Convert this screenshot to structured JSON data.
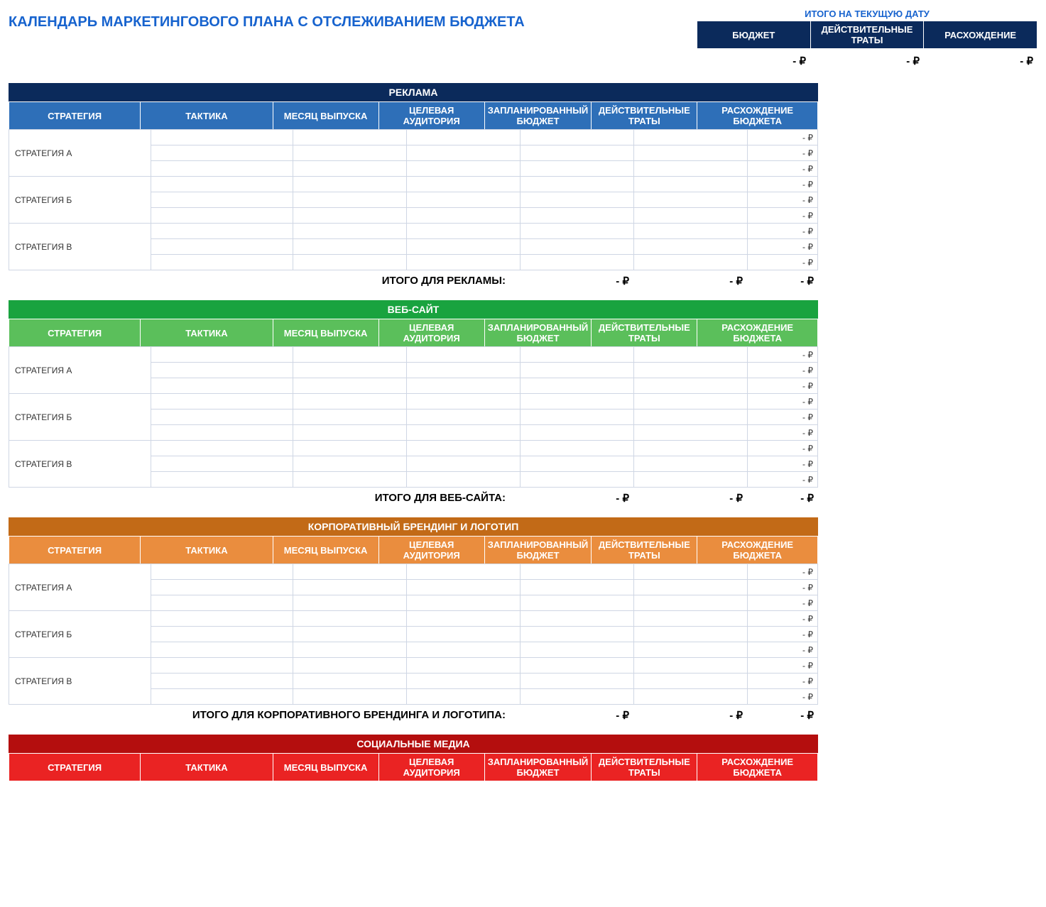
{
  "page_title": "КАЛЕНДАРЬ МАРКЕТИНГОВОГО ПЛАНА С ОТСЛЕЖИВАНИЕМ БЮДЖЕТА",
  "summary": {
    "top_label": "ИТОГО НА ТЕКУЩУЮ ДАТУ",
    "headers": [
      "БЮДЖЕТ",
      "ДЕЙСТВИТЕЛЬНЫЕ ТРАТЫ",
      "РАСХОЖДЕНИЕ"
    ],
    "values": [
      "-   ₽",
      "-   ₽",
      "-   ₽"
    ]
  },
  "col_headers": [
    "СТРАТЕГИЯ",
    "ТАКТИКА",
    "МЕСЯЦ ВЫПУСКА",
    "ЦЕЛЕВАЯ АУДИТОРИЯ",
    "ЗАПЛАНИРОВАННЫЙ БЮДЖЕТ",
    "ДЕЙСТВИТЕЛЬНЫЕ ТРАТЫ",
    "РАСХОЖДЕНИЕ БЮДЖЕТА"
  ],
  "row_var_value": "-   ₽",
  "strategies": [
    "СТРАТЕГИЯ А",
    "СТРАТЕГИЯ Б",
    "СТРАТЕГИЯ В"
  ],
  "sections": [
    {
      "title": "РЕКЛАМА",
      "title_class": "blue-title",
      "col_class": "blue-cols",
      "total_label": "ИТОГО ДЛЯ РЕКЛАМЫ:",
      "totals": [
        "-   ₽",
        "-   ₽",
        "-   ₽"
      ],
      "has_body": true
    },
    {
      "title": "ВЕБ-САЙТ",
      "title_class": "green-title",
      "col_class": "green-cols",
      "total_label": "ИТОГО ДЛЯ ВЕБ-САЙТА:",
      "totals": [
        "-   ₽",
        "-   ₽",
        "-   ₽"
      ],
      "has_body": true
    },
    {
      "title": "КОРПОРАТИВНЫЙ БРЕНДИНГ И ЛОГОТИП",
      "title_class": "orange-title",
      "col_class": "orange-cols",
      "total_label": "ИТОГО ДЛЯ КОРПОРАТИВНОГО БРЕНДИНГА И ЛОГОТИПА:",
      "totals": [
        "-   ₽",
        "-   ₽",
        "-   ₽"
      ],
      "has_body": true
    },
    {
      "title": "СОЦИАЛЬНЫЕ МЕДИА",
      "title_class": "red-title",
      "col_class": "red-cols",
      "total_label": "",
      "totals": [],
      "has_body": false
    }
  ]
}
